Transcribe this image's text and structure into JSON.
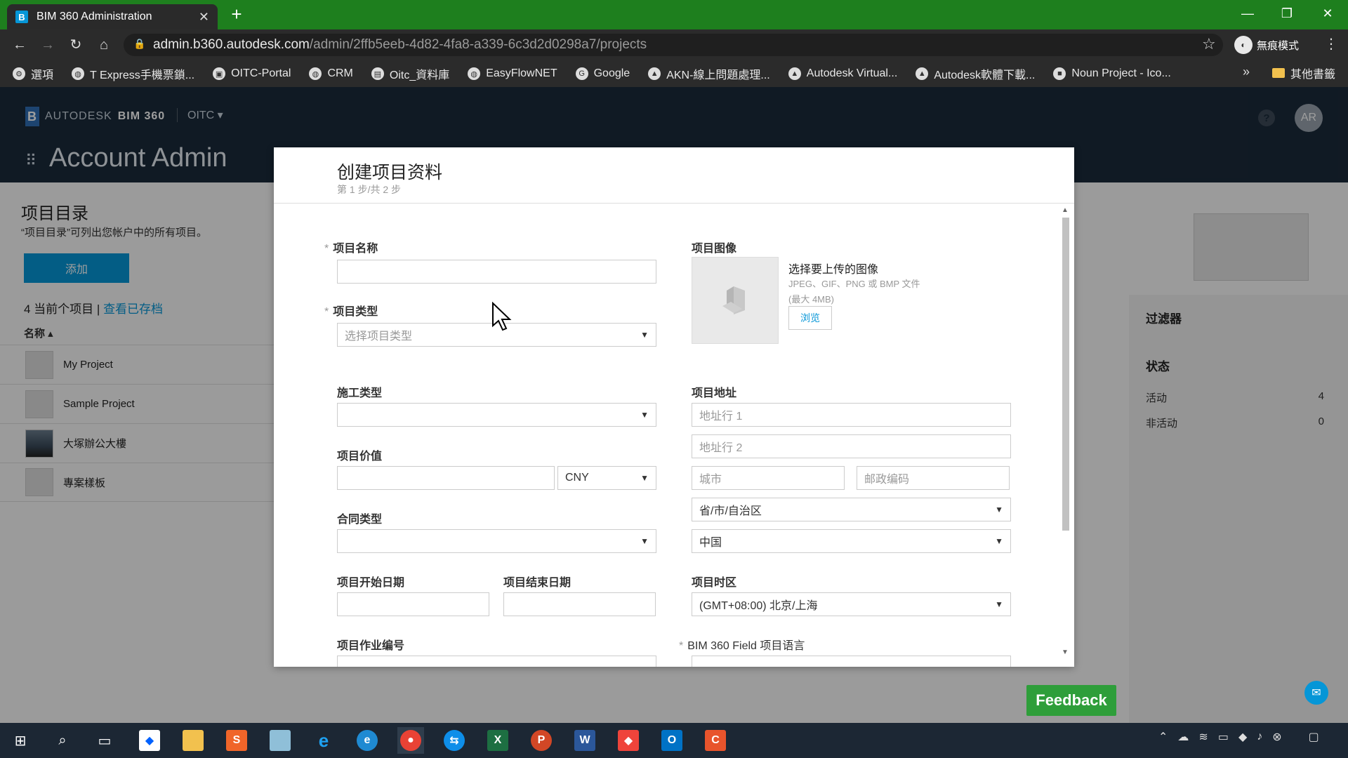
{
  "browser": {
    "tab_title": "BIM 360 Administration",
    "url_host": "admin.b360.autodesk.com",
    "url_path": "/admin/2ffb5eeb-4d82-4fa8-a339-6c3d2d0298a7/projects",
    "incognito_label": "無痕模式",
    "bookmarks": [
      "選項",
      "T Express手機票鎖...",
      "OITC-Portal",
      "CRM",
      "Oitc_資料庫",
      "EasyFlowNET",
      "Google",
      "AKN-線上問題處理...",
      "Autodesk Virtual...",
      "Autodesk軟體下載...",
      "Noun Project - Ico..."
    ],
    "bookmarks_other": "其他書籤"
  },
  "app": {
    "brand": "AUTODESK",
    "product": "BIM 360",
    "account": "OITC",
    "section_title": "Account Admin",
    "avatar_initials": "AR",
    "help": "?"
  },
  "page": {
    "title": "项目目录",
    "subtitle": "“项目目录”可列出您帐户中的所有项目。",
    "add_button": "添加",
    "count_label": "4 当前个项目",
    "archive_link": "查看已存档",
    "name_column": "名称",
    "projects": [
      "My Project",
      "Sample Project",
      "大塚辦公大樓",
      "專案樣板"
    ],
    "filter_title": "过滤器",
    "status_title": "状态",
    "status_rows": [
      {
        "label": "活动",
        "count": "4"
      },
      {
        "label": "非活动",
        "count": "0"
      }
    ]
  },
  "modal": {
    "title": "创建项目资料",
    "step": "第 1 步/共 2 步",
    "project_name_label": "项目名称",
    "project_name_value": "",
    "project_type_label": "项目类型",
    "project_type_placeholder": "选择项目类型",
    "construction_type_label": "施工类型",
    "project_value_label": "项目价值",
    "currency": "CNY",
    "contract_type_label": "合同类型",
    "start_date_label": "项目开始日期",
    "end_date_label": "项目结束日期",
    "job_number_label": "项目作业编号",
    "image_label": "项目图像",
    "image_select": "选择要上传的图像",
    "image_formats": "JPEG、GIF、PNG 或 BMP 文件",
    "image_max": "(最大 4MB)",
    "browse": "浏览",
    "address_label": "项目地址",
    "address1_placeholder": "地址行 1",
    "address2_placeholder": "地址行 2",
    "city_placeholder": "城市",
    "zip_placeholder": "邮政编码",
    "province_value": "省/市/自治区",
    "country_value": "中国",
    "timezone_label": "项目时区",
    "timezone_value": "(GMT+08:00) 北京/上海",
    "field_lang_label": "BIM 360 Field 项目语言",
    "required_mark": "*"
  },
  "feedback": "Feedback",
  "colors": {
    "tabbar": "#1e7f1e",
    "app_header": "#1b2a3a",
    "accent": "#0696d7",
    "feedback": "#2e9e3a"
  }
}
